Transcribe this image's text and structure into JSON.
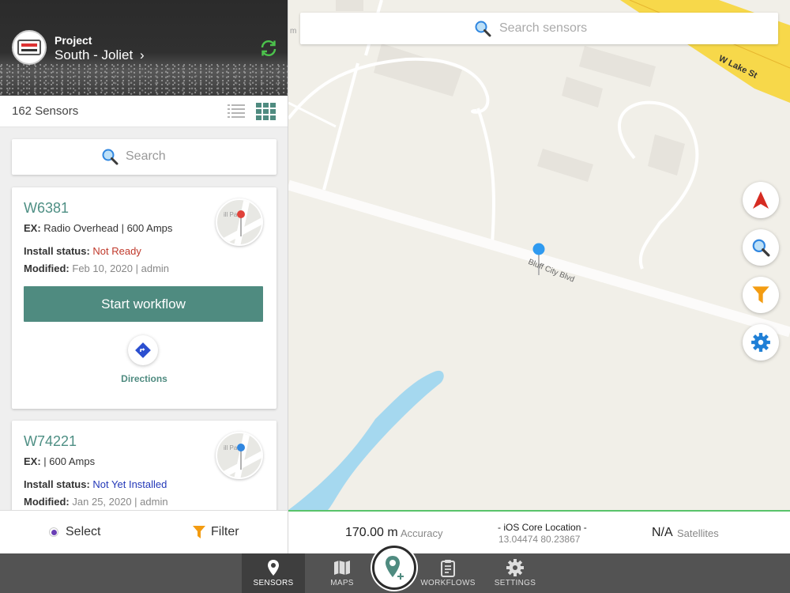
{
  "header": {
    "project_label": "Project",
    "project_name": "South - Joliet",
    "chevron": "›",
    "logo_icon": "company-logo",
    "refresh_icon": "refresh-icon"
  },
  "list": {
    "count_label": "162 Sensors",
    "search_placeholder": "Search"
  },
  "cards": [
    {
      "id": "W6381",
      "ex_label": "EX:",
      "ex_value": "Radio Overhead | 600 Amps",
      "status_label": "Install status:",
      "status_value": "Not Ready",
      "modified_label": "Modified:",
      "modified_value": "Feb 10, 2020 | admin",
      "button_label": "Start workflow",
      "directions_label": "Directions",
      "pin_color": "#e0423a"
    },
    {
      "id": "W74221",
      "ex_label": "EX:",
      "ex_value": " | 600 Amps",
      "status_label": "Install status:",
      "status_value": "Not Yet Installed",
      "modified_label": "Modified:",
      "modified_value": "Jan 25, 2020 | admin",
      "pin_color": "#2f86e0"
    }
  ],
  "bottom_actions": {
    "select_label": "Select",
    "filter_label": "Filter"
  },
  "map": {
    "search_placeholder": "Search sensors",
    "street_lake": "W Lake St",
    "street_bluff": "Bluff City Blvd",
    "edge_label": "m"
  },
  "status": {
    "accuracy_value": "170.00 m",
    "accuracy_label": "Accuracy",
    "location_title": "- iOS Core Location -",
    "location_coords": "13.04474 80.23867",
    "satellites_value": "N/A",
    "satellites_label": "Satellites"
  },
  "tabs": [
    {
      "label": "SENSORS",
      "icon": "map-pin-icon",
      "active": true
    },
    {
      "label": "MAPS",
      "icon": "map-icon"
    },
    {
      "label": "WORKFLOWS",
      "icon": "clipboard-icon"
    },
    {
      "label": "SETTINGS",
      "icon": "gear-icon"
    }
  ],
  "colors": {
    "accent": "#4f8b80",
    "status_red": "#c0392b",
    "status_blue": "#2338b8",
    "filter_orange": "#f39c12",
    "gps_green": "#59c36a"
  }
}
